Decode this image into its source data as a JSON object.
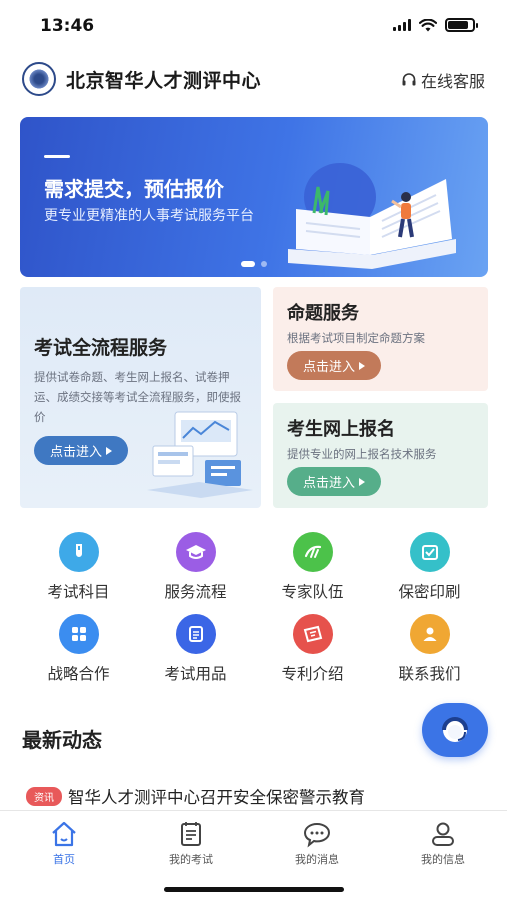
{
  "status_bar": {
    "time": "13:46",
    "battery_level": 0.85
  },
  "header": {
    "title": "北京智华人才测评中心",
    "service_link": "在线客服",
    "service_icon": "headset-icon"
  },
  "banner": {
    "title": "需求提交，预估报价",
    "subtitle": "更专业更精准的人事考试服务平台",
    "slides": 2,
    "active_slide": 1,
    "colors": {
      "start": "#2f54c9",
      "end": "#6aa3f3"
    }
  },
  "services": {
    "main": {
      "title": "考试全流程服务",
      "desc": "提供试卷命题、考生网上报名、试卷押运、成绩交接等考试全流程服务，即使报价",
      "button": "点击进入"
    },
    "proposition": {
      "title": "命题服务",
      "desc": "根据考试项目制定命题方案",
      "button": "点击进入"
    },
    "registration": {
      "title": "考生网上报名",
      "desc": "提供专业的网上报名技术服务",
      "button": "点击进入"
    }
  },
  "grid": [
    {
      "label": "考试科目",
      "icon": "test-tube-icon",
      "color": "#3ea9e8"
    },
    {
      "label": "服务流程",
      "icon": "graduation-cap-icon",
      "color": "#9b5de5"
    },
    {
      "label": "专家队伍",
      "icon": "team-badge-icon",
      "color": "#4cc24a"
    },
    {
      "label": "保密印刷",
      "icon": "secure-print-icon",
      "color": "#35c0c9"
    },
    {
      "label": "战略合作",
      "icon": "grid-apps-icon",
      "color": "#3b8df0"
    },
    {
      "label": "考试用品",
      "icon": "document-list-icon",
      "color": "#3b66e6"
    },
    {
      "label": "专利介绍",
      "icon": "ticket-icon",
      "color": "#e6524c"
    },
    {
      "label": "联系我们",
      "icon": "contact-user-icon",
      "color": "#f0a733"
    }
  ],
  "news": {
    "heading": "最新动态",
    "badge": "资讯",
    "item_title": "智华人才测评中心召开安全保密警示教育"
  },
  "tabs": [
    {
      "label": "首页",
      "icon": "home-icon",
      "active": true
    },
    {
      "label": "我的考试",
      "icon": "exam-icon",
      "active": false
    },
    {
      "label": "我的消息",
      "icon": "message-icon",
      "active": false
    },
    {
      "label": "我的信息",
      "icon": "profile-icon",
      "active": false
    }
  ],
  "accent_color": "#3b74e6"
}
